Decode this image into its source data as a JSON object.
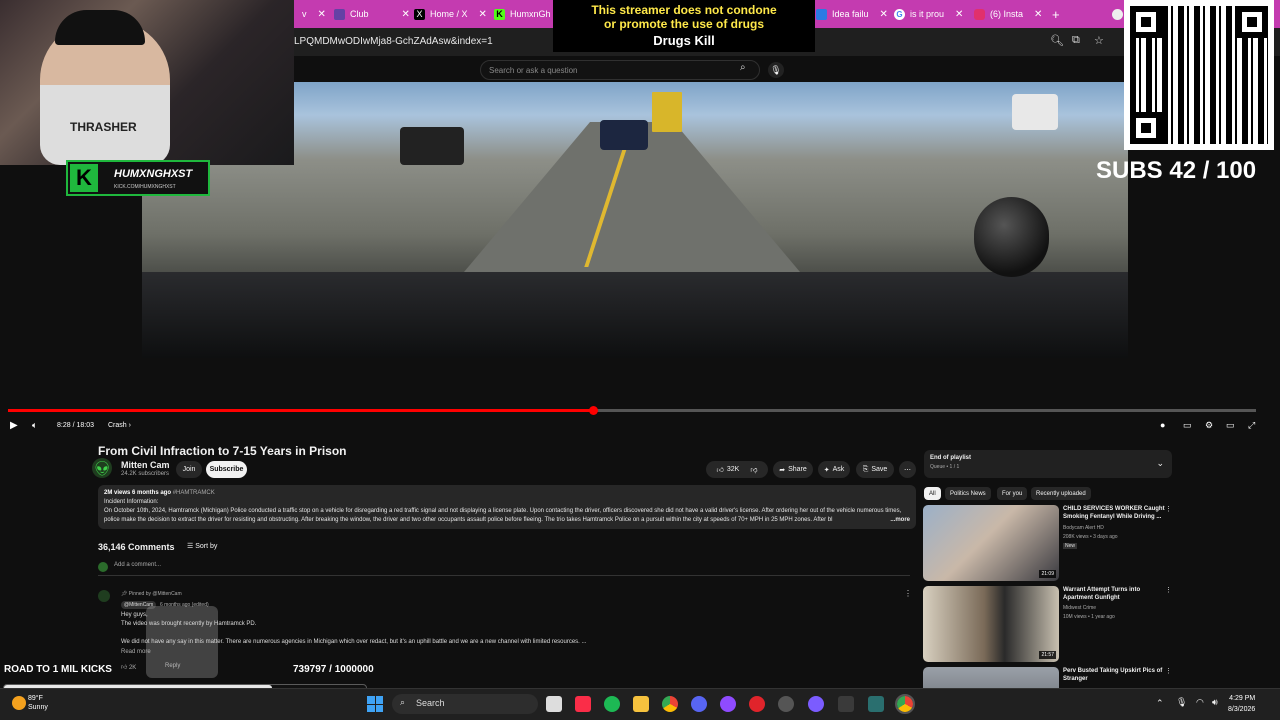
{
  "browser": {
    "tabs": [
      {
        "label": "Club",
        "color": "#6441a5"
      },
      {
        "label": "Home / X",
        "color": "#000000"
      },
      {
        "label": "HumxnGh",
        "color": "#53fc18"
      },
      {
        "label": "Idea failu",
        "color": "#2a7ae4"
      },
      {
        "label": "is it prou",
        "color": "#4285f4"
      },
      {
        "label": "(6) Insta",
        "color": "#e1306c"
      }
    ],
    "url": "LPQMDMwODIwMja8-GchZAdAsw&index=1"
  },
  "overlay": {
    "banner_line1": "This streamer does not condone",
    "banner_line2": "or promote the use of drugs",
    "banner_line3": "Drugs Kill",
    "subs_goal": "SUBS 42 / 100",
    "streamer_name": "HUMXNGHXST",
    "streamer_sub": "KICK.COM/HUMXNGHXST",
    "shirt_text": "THRASHER",
    "road_label": "ROAD TO 1 MIL KICKS",
    "road_count": "739797 / 1000000",
    "road_progress": 0.7398
  },
  "youtube": {
    "search_placeholder": "Search or ask a question",
    "player": {
      "time": "8:28 / 18:03",
      "chapter": "Crash",
      "progress": 0.469
    },
    "video": {
      "title": "From Civil Infraction to 7-15 Years in Prison",
      "channel": "Mitten Cam",
      "subscribers": "24.2K subscribers",
      "join_label": "Join",
      "subscribe_label": "Subscribe",
      "likes": "32K",
      "share_label": "Share",
      "ask_label": "Ask",
      "save_label": "Save"
    },
    "description": {
      "meta": "2M views  6 months ago",
      "tag": "#HAMTRAMCK",
      "heading": "Incident Information:",
      "body": "On October 10th, 2024, Hamtramck (Michigan) Police conducted a traffic stop on a vehicle for disregarding a red traffic signal and not displaying a license plate. Upon contacting the driver, officers discovered she did not have a valid driver's license. After ordering her out of the vehicle numerous times, police make the decision to extract the driver for resisting and obstructing. After breaking the window, the driver and two other occupants assault police before fleeing. The trio takes Hamtramck Police on a pursuit within the city at speeds of 70+ MPH in 25 MPH zones. After bl",
      "more": "...more"
    },
    "comments": {
      "count": "36,146 Comments",
      "sort_label": "Sort by",
      "add_placeholder": "Add a comment...",
      "pinned_label": "Pinned by @MittenCam",
      "pinned_author": "@MittenCam",
      "pinned_time": "6 months ago (edited)",
      "line1": "Hey guys,",
      "line2": "The video was brought recently by Hamtramck PD.",
      "line3": "We did not have any say in this matter. There are numerous agencies in Michigan which over redact, but it's an uphill battle and we are a new channel with limited resources. ...",
      "read_more": "Read more",
      "likes": "2K",
      "reply": "Reply"
    },
    "playlist": {
      "title": "End of playlist",
      "queue": "Queue • 1 / 1"
    },
    "chips": [
      "All",
      "Politics News",
      "For you",
      "Recently uploaded"
    ],
    "recommendations": [
      {
        "title": "CHILD SERVICES WORKER Caught Smoking Fentanyl While Driving ...",
        "channel": "Bodycam Alert HD",
        "meta": "208K views • 3 days ago",
        "badge": "New",
        "duration": "21:09"
      },
      {
        "title": "Warrant Attempt Turns into Apartment Gunfight",
        "channel": "Midwest Crime",
        "meta": "10M views • 1 year ago",
        "badge": "",
        "duration": "21:57"
      },
      {
        "title": "Perv Busted Taking Upskirt Pics of Stranger",
        "channel": "",
        "meta": "",
        "badge": "",
        "duration": ""
      }
    ]
  },
  "taskbar": {
    "temp": "89°F",
    "condition": "Sunny",
    "search_label": "Search",
    "time": "4:29 PM",
    "date": "8/3/2026"
  }
}
